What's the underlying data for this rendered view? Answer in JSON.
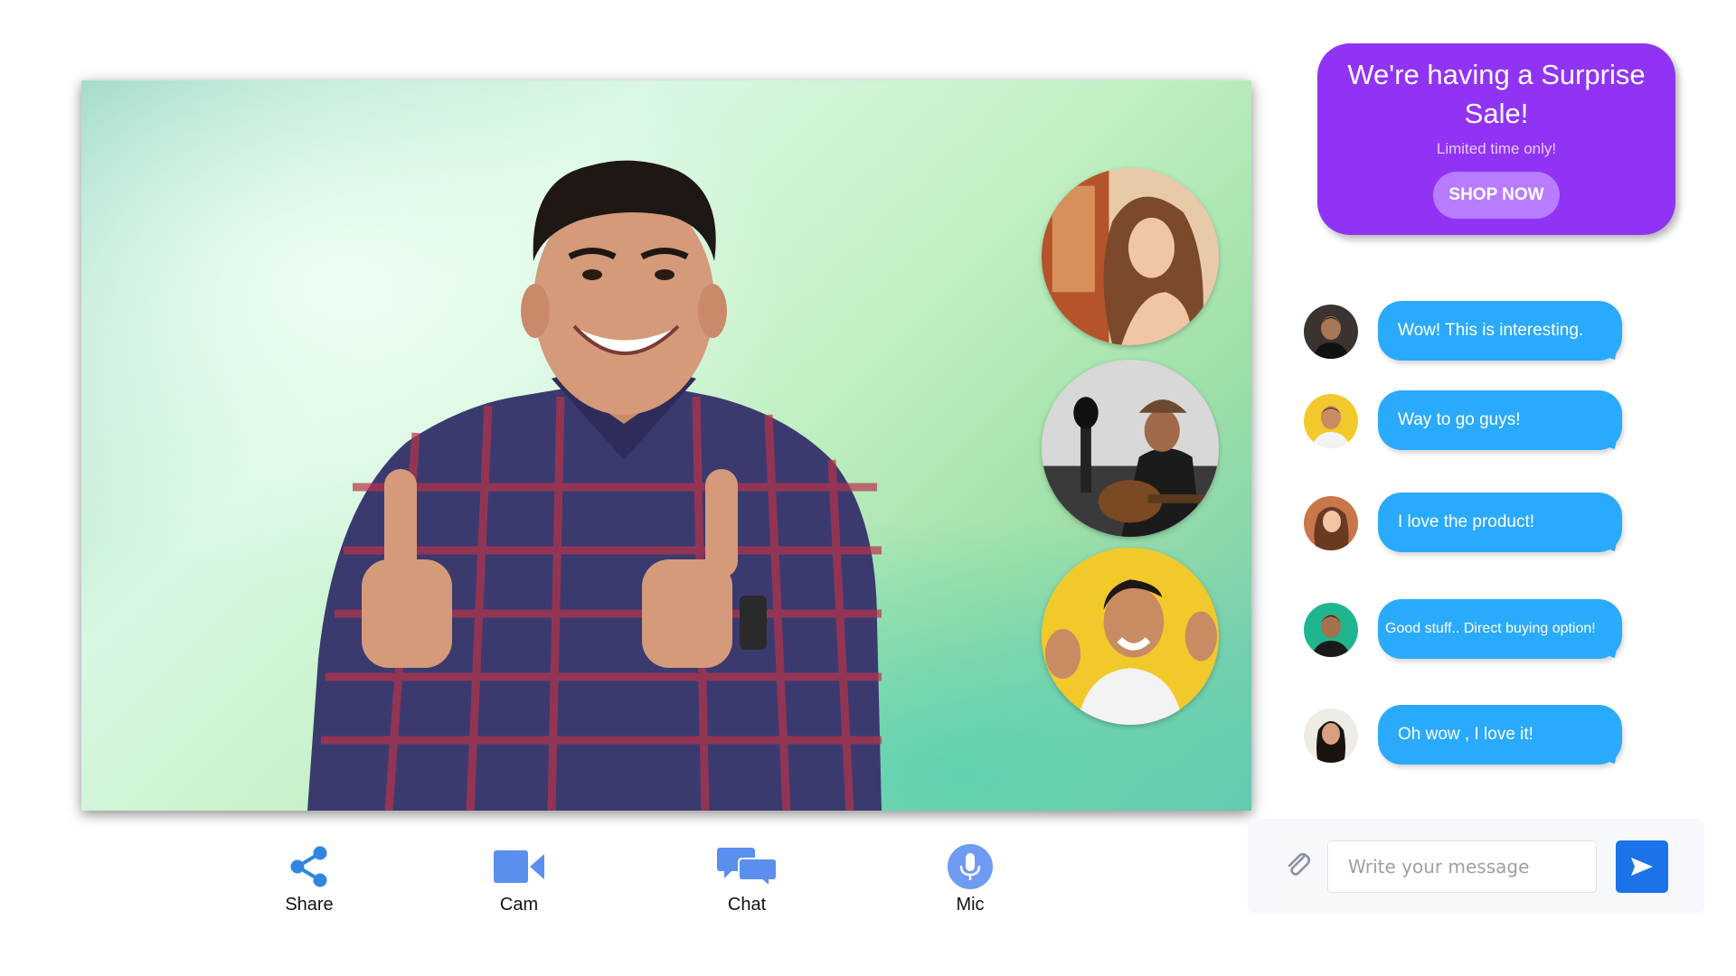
{
  "call": {
    "presenter_image": "presenter-video",
    "participants": [
      {
        "image": "participant-woman-portrait"
      },
      {
        "image": "participant-guitar-player"
      },
      {
        "image": "participant-smiling-man"
      }
    ]
  },
  "controls": [
    {
      "label": "Share",
      "icon": "share-icon"
    },
    {
      "label": "Cam",
      "icon": "camera-icon"
    },
    {
      "label": "Chat",
      "icon": "chat-icon"
    },
    {
      "label": "Mic",
      "icon": "mic-icon"
    }
  ],
  "promo": {
    "title": "We're having a Surprise Sale!",
    "subtitle": "Limited time only!",
    "button_label": "SHOP NOW",
    "background_color": "#9133f5",
    "button_color": "#b77cff"
  },
  "chat": {
    "bubble_color": "#2aaafc",
    "messages": [
      {
        "text": "Wow! This is interesting."
      },
      {
        "text": "Way to go guys!"
      },
      {
        "text": "I love the product!"
      },
      {
        "text": "Good stuff.. Direct buying option!"
      },
      {
        "text": "Oh wow , I love it!"
      }
    ]
  },
  "composer": {
    "placeholder": "Write your message",
    "attach_icon": "paperclip-icon",
    "send_icon": "send-icon",
    "send_color": "#1a73e8"
  }
}
